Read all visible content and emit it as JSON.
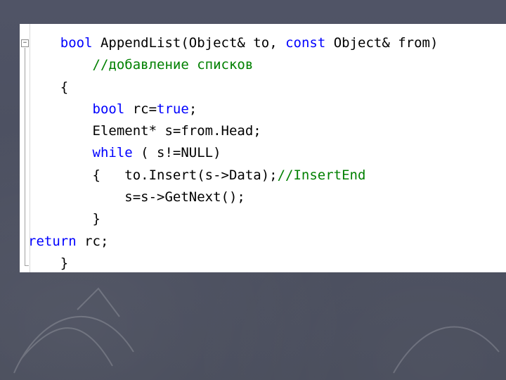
{
  "colors": {
    "keyword": "#0000ff",
    "comment": "#008000",
    "text": "#000000",
    "editor_background": "#ffffff",
    "slide_background": "#4b4f5f"
  },
  "gutter": {
    "collapse_glyph": "−",
    "icon": "collapse-toggle-icon"
  },
  "code_lines": [
    [
      {
        "t": "    ",
        "k": "text"
      },
      {
        "t": "bool",
        "k": "keyword"
      },
      {
        "t": " AppendList(Object& to, ",
        "k": "text"
      },
      {
        "t": "const",
        "k": "keyword"
      },
      {
        "t": " Object& from)",
        "k": "text"
      }
    ],
    [
      {
        "t": "        ",
        "k": "text"
      },
      {
        "t": "//добавление списков",
        "k": "comment"
      }
    ],
    [
      {
        "t": "    {",
        "k": "text"
      }
    ],
    [
      {
        "t": "        ",
        "k": "text"
      },
      {
        "t": "bool",
        "k": "keyword"
      },
      {
        "t": " rc=",
        "k": "text"
      },
      {
        "t": "true",
        "k": "keyword"
      },
      {
        "t": ";",
        "k": "text"
      }
    ],
    [
      {
        "t": "        Element* s=from.Head;",
        "k": "text"
      }
    ],
    [
      {
        "t": "        ",
        "k": "text"
      },
      {
        "t": "while",
        "k": "keyword"
      },
      {
        "t": " ( s!=NULL)",
        "k": "text"
      }
    ],
    [
      {
        "t": "        {   to.Insert(s->Data);",
        "k": "text"
      },
      {
        "t": "//InsertEnd",
        "k": "comment"
      }
    ],
    [
      {
        "t": "            s=s->GetNext();",
        "k": "text"
      }
    ],
    [
      {
        "t": "        }",
        "k": "text"
      }
    ],
    [
      {
        "t": "return",
        "k": "keyword"
      },
      {
        "t": " rc;",
        "k": "text"
      }
    ],
    [
      {
        "t": "    }",
        "k": "text"
      }
    ]
  ]
}
